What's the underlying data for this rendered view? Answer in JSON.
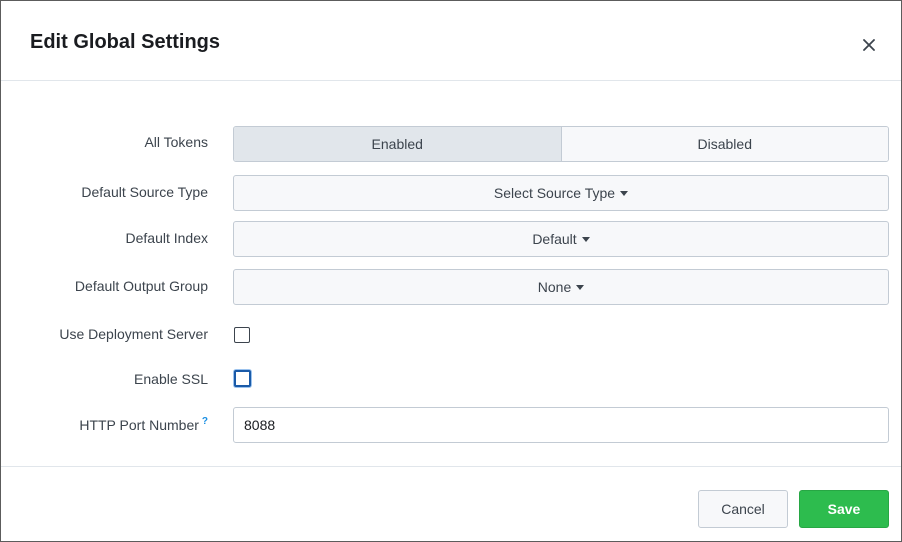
{
  "dialog": {
    "title": "Edit Global Settings",
    "close_icon": "close-icon"
  },
  "form": {
    "all_tokens": {
      "label": "All Tokens",
      "options": [
        "Enabled",
        "Disabled"
      ],
      "selected": "Enabled"
    },
    "default_source_type": {
      "label": "Default Source Type",
      "value": "Select Source Type"
    },
    "default_index": {
      "label": "Default Index",
      "value": "Default"
    },
    "default_output_group": {
      "label": "Default Output Group",
      "value": "None"
    },
    "use_deployment_server": {
      "label": "Use Deployment Server",
      "checked": false
    },
    "enable_ssl": {
      "label": "Enable SSL",
      "checked": false
    },
    "http_port_number": {
      "label": "HTTP Port Number",
      "help": "?",
      "value": "8088"
    }
  },
  "footer": {
    "cancel_label": "Cancel",
    "save_label": "Save"
  },
  "colors": {
    "save_green": "#2dbc4e",
    "focus_blue": "#1a5aa8",
    "help_blue": "#1a8fe3"
  }
}
